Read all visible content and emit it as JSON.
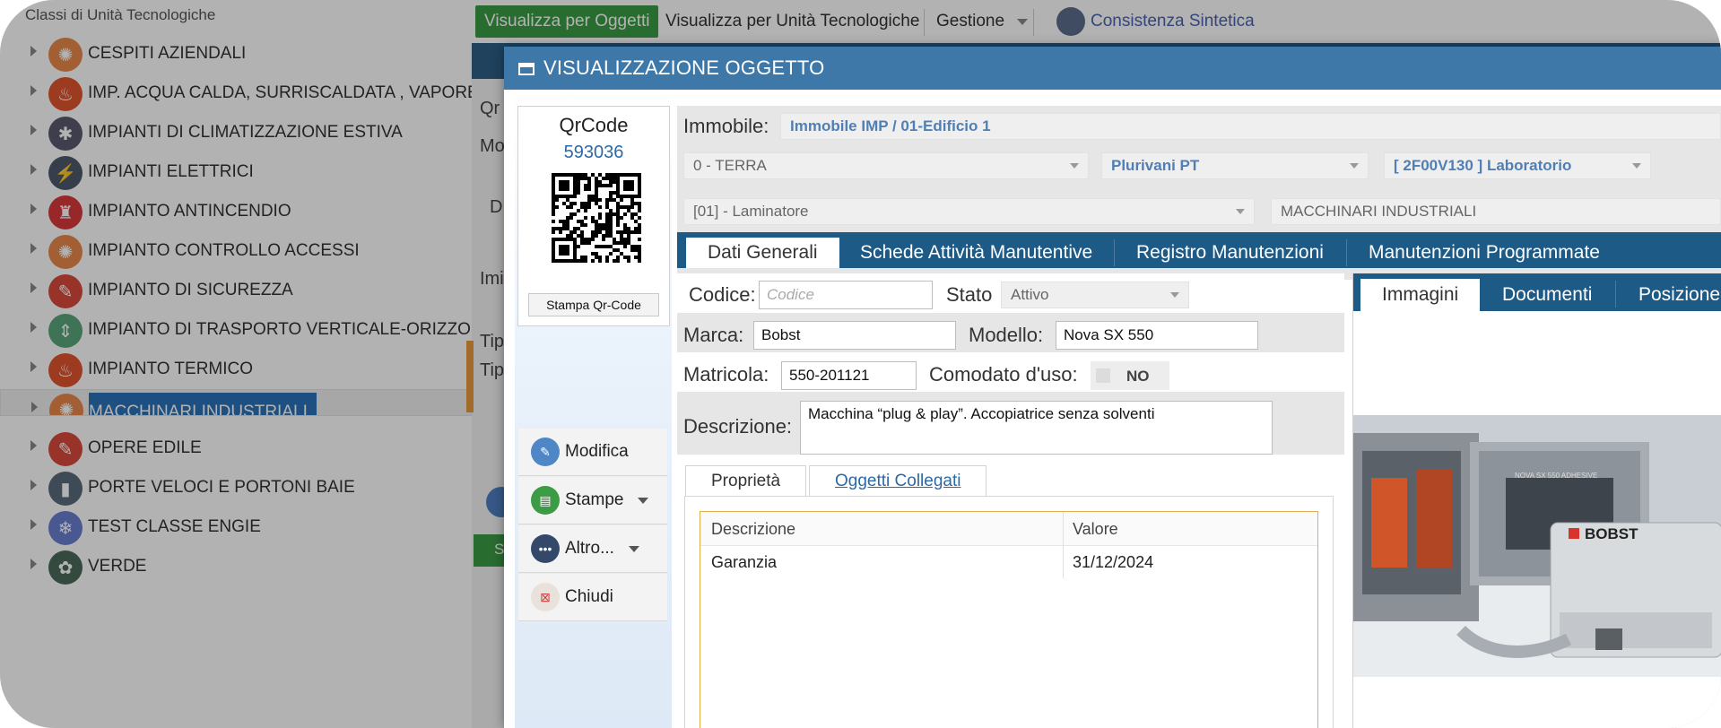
{
  "tree": {
    "title": "Classi di Unità Tecnologiche",
    "items": [
      {
        "label": "CESPITI AZIENDALI",
        "color": "#e8884a",
        "glyph": "✺",
        "icon": "atom-icon"
      },
      {
        "label": "IMP. ACQUA CALDA, SURRISCALDATA , VAPORE,",
        "color": "#e0552f",
        "glyph": "♨",
        "icon": "flame-icon"
      },
      {
        "label": "IMPIANTI DI CLIMATIZZAZIONE ESTIVA",
        "color": "#5a5a6e",
        "glyph": "✱",
        "icon": "snow-sun-icon"
      },
      {
        "label": "IMPIANTI ELETTRICI",
        "color": "#4c5a6a",
        "glyph": "⚡",
        "icon": "plug-icon"
      },
      {
        "label": "IMPIANTO ANTINCENDIO",
        "color": "#d9383a",
        "glyph": "♜",
        "icon": "extinguisher-icon"
      },
      {
        "label": "IMPIANTO CONTROLLO ACCESSI",
        "color": "#e8884a",
        "glyph": "✺",
        "icon": "atom-icon"
      },
      {
        "label": "IMPIANTO DI SICUREZZA",
        "color": "#d94a3a",
        "glyph": "✎",
        "icon": "pencil-icon"
      },
      {
        "label": "IMPIANTO DI TRASPORTO VERTICALE-ORIZZONTALE",
        "color": "#5aa57a",
        "glyph": "⇕",
        "icon": "elevator-icon"
      },
      {
        "label": "IMPIANTO TERMICO",
        "color": "#e0552f",
        "glyph": "♨",
        "icon": "flame-icon"
      },
      {
        "label": "MACCHINARI INDUSTRIALI",
        "color": "#e8884a",
        "glyph": "✺",
        "icon": "atom-icon"
      },
      {
        "label": "OPERE EDILE",
        "color": "#d94a3a",
        "glyph": "✎",
        "icon": "pencil-icon"
      },
      {
        "label": "PORTE VELOCI E PORTONI BAIE",
        "color": "#5a6a7a",
        "glyph": "▮",
        "icon": "door-icon"
      },
      {
        "label": "TEST CLASSE ENGIE",
        "color": "#6a7fd0",
        "glyph": "❄",
        "icon": "snowflake-icon"
      },
      {
        "label": "VERDE",
        "color": "#4c6a5a",
        "glyph": "✿",
        "icon": "flower-icon"
      }
    ],
    "selected_label": "MACCHINARI INDUSTRIALI"
  },
  "topbar": {
    "view_objects": "Visualizza per Oggetti",
    "view_units": "Visualizza per Unità Tecnologiche",
    "management": "Gestione",
    "summary": "Consistenza Sintetica"
  },
  "bg_fragments": {
    "a": "Qr",
    "b": "Mo",
    "c": "D",
    "d": "Imi",
    "e": "Tip",
    "f": "Tip",
    "g": "S"
  },
  "modal": {
    "title": "VISUALIZZAZIONE OGGETTO",
    "qr": {
      "title": "QrCode",
      "number": "593036",
      "print_button": "Stampa Qr-Code"
    },
    "actions": {
      "edit": "Modifica",
      "print": "Stampe",
      "more": "Altro...",
      "close": "Chiudi"
    },
    "location": {
      "building_label": "Immobile:",
      "building_value": "Immobile IMP / 01-Edificio 1",
      "floor": "0 - TERRA",
      "area": "Plurivani PT",
      "room": "[ 2F00V130 ] Laboratorio",
      "object": "[01] - Laminatore",
      "class": "MACCHINARI INDUSTRIALI"
    },
    "tabs": [
      "Dati Generali",
      "Schede Attività Manutentive",
      "Registro Manutenzioni",
      "Manutenzioni Programmate"
    ],
    "general": {
      "code_label": "Codice:",
      "code_placeholder": "Codice",
      "status_label": "Stato",
      "status_value": "Attivo",
      "brand_label": "Marca:",
      "brand_value": "Bobst",
      "model_label": "Modello:",
      "model_value": "Nova SX 550",
      "serial_label": "Matricola:",
      "serial_value": "550-201121",
      "loan_label": "Comodato d'uso:",
      "loan_value": "NO",
      "desc_label": "Descrizione:",
      "desc_value": "Macchina “plug & play”. Accopiatrice senza solventi"
    },
    "subtabs": [
      "Proprietà",
      "Oggetti Collegati"
    ],
    "properties": {
      "headers": [
        "Descrizione",
        "Valore"
      ],
      "rows": [
        {
          "name": "Garanzia",
          "value": "31/12/2024"
        }
      ]
    },
    "media_tabs": [
      "Immagini",
      "Documenti",
      "Posizione"
    ],
    "photo_text": {
      "brand": "BOBST",
      "model": "NOVA SX 550 ADHESIVE"
    }
  },
  "colors": {
    "accent_blue": "#1e5a86",
    "header_blue": "#3d78a8",
    "active_green": "#3c9b45",
    "selection_blue": "#2a73b8"
  }
}
